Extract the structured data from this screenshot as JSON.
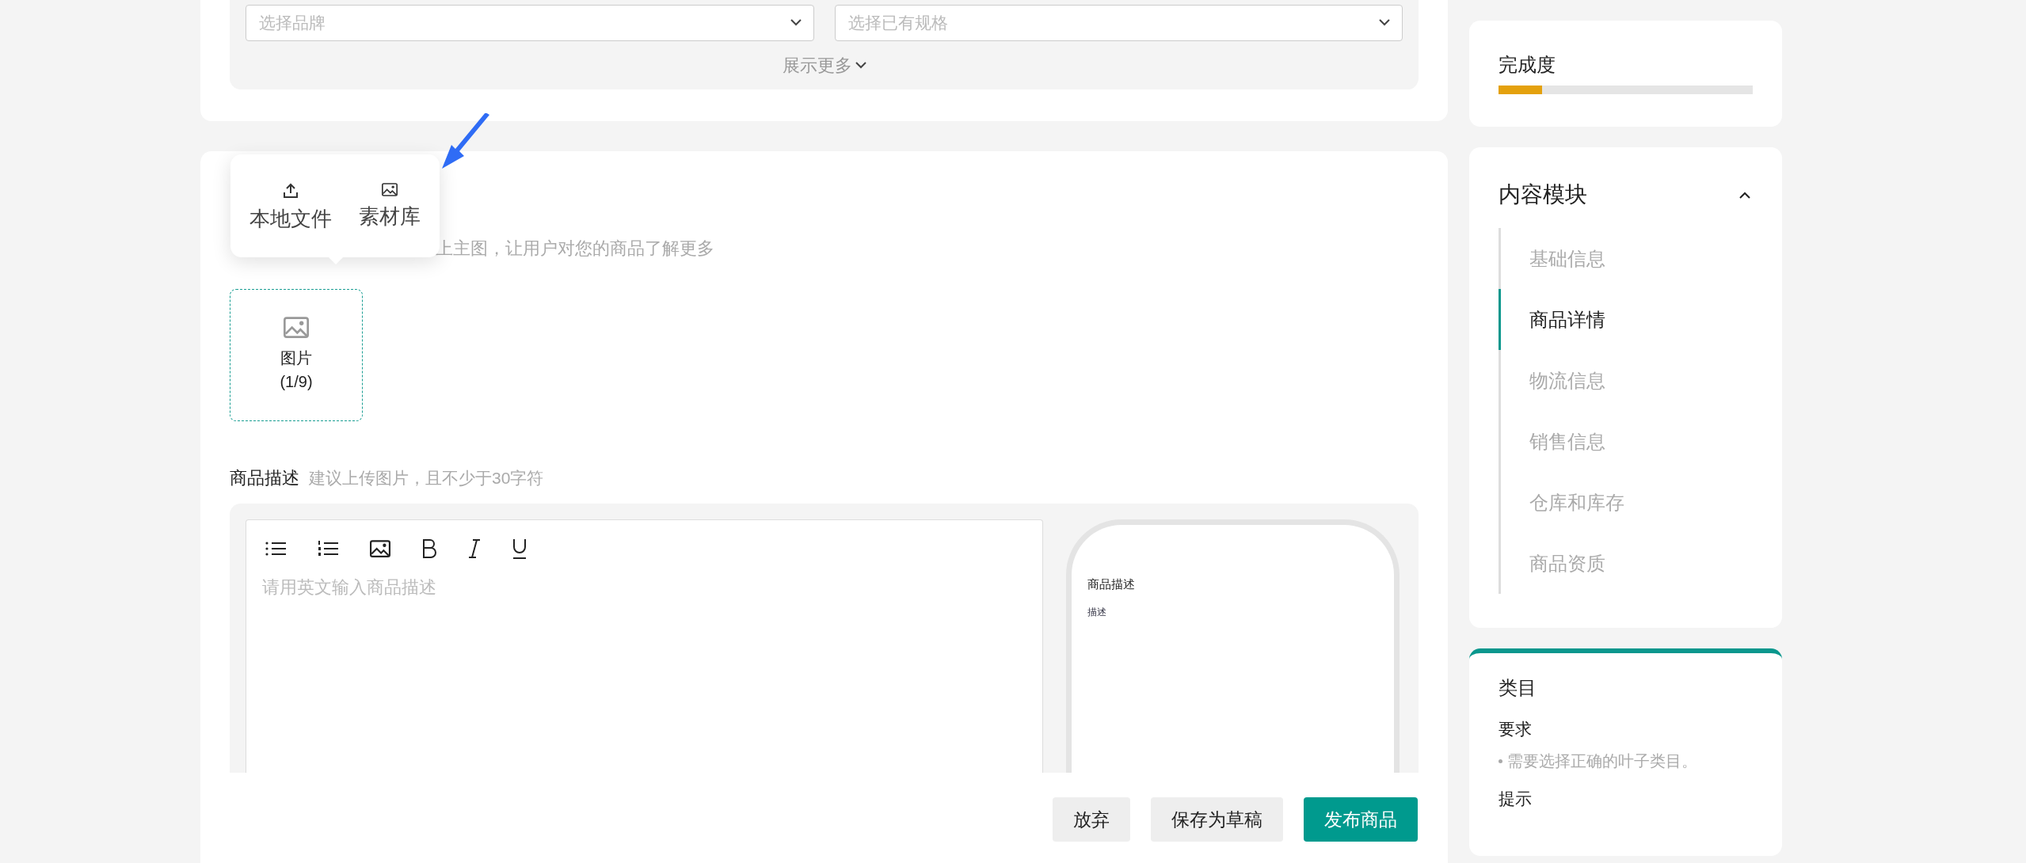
{
  "filters": {
    "fields": [
      {
        "placeholder": "选择品牌"
      },
      {
        "placeholder": "选择已有规格"
      }
    ],
    "show_more": "展示更多"
  },
  "upload_popover": {
    "options": [
      {
        "kind": "upload",
        "label": "本地文件"
      },
      {
        "kind": "library",
        "label": "素材库"
      }
    ]
  },
  "images": {
    "hint": "上主图，让用户对您的商品了解更多",
    "upload_box": {
      "label": "图片",
      "count": "(1/9)"
    }
  },
  "description": {
    "label": "商品描述",
    "hint": "建议上传图片，且不少于30字符",
    "toolbar": [
      {
        "kind": "bullet-list"
      },
      {
        "kind": "numbered-list"
      },
      {
        "kind": "image"
      },
      {
        "kind": "bold"
      },
      {
        "kind": "italic"
      },
      {
        "kind": "underline"
      }
    ],
    "placeholder": "请用英文输入商品描述",
    "preview": {
      "title": "商品描述",
      "text": "描述"
    }
  },
  "actions": [
    {
      "kind": "secondary",
      "label": "放弃"
    },
    {
      "kind": "secondary",
      "label": "保存为草稿"
    },
    {
      "kind": "primary",
      "label": "发布商品"
    }
  ],
  "sidebar": {
    "completion": {
      "title": "完成度",
      "level": 0.17
    },
    "modules": {
      "title": "内容模块",
      "expanded": true,
      "items": [
        {
          "label": "基础信息",
          "selected": false
        },
        {
          "label": "商品详情",
          "selected": true
        },
        {
          "label": "物流信息",
          "selected": false
        },
        {
          "label": "销售信息",
          "selected": false
        },
        {
          "label": "仓库和库存",
          "selected": false
        },
        {
          "label": "商品资质",
          "selected": false
        }
      ]
    },
    "category": {
      "title": "类目",
      "requirement_label": "要求",
      "requirement": "需要选择正确的叶子类目。",
      "tip_label": "提示"
    }
  }
}
